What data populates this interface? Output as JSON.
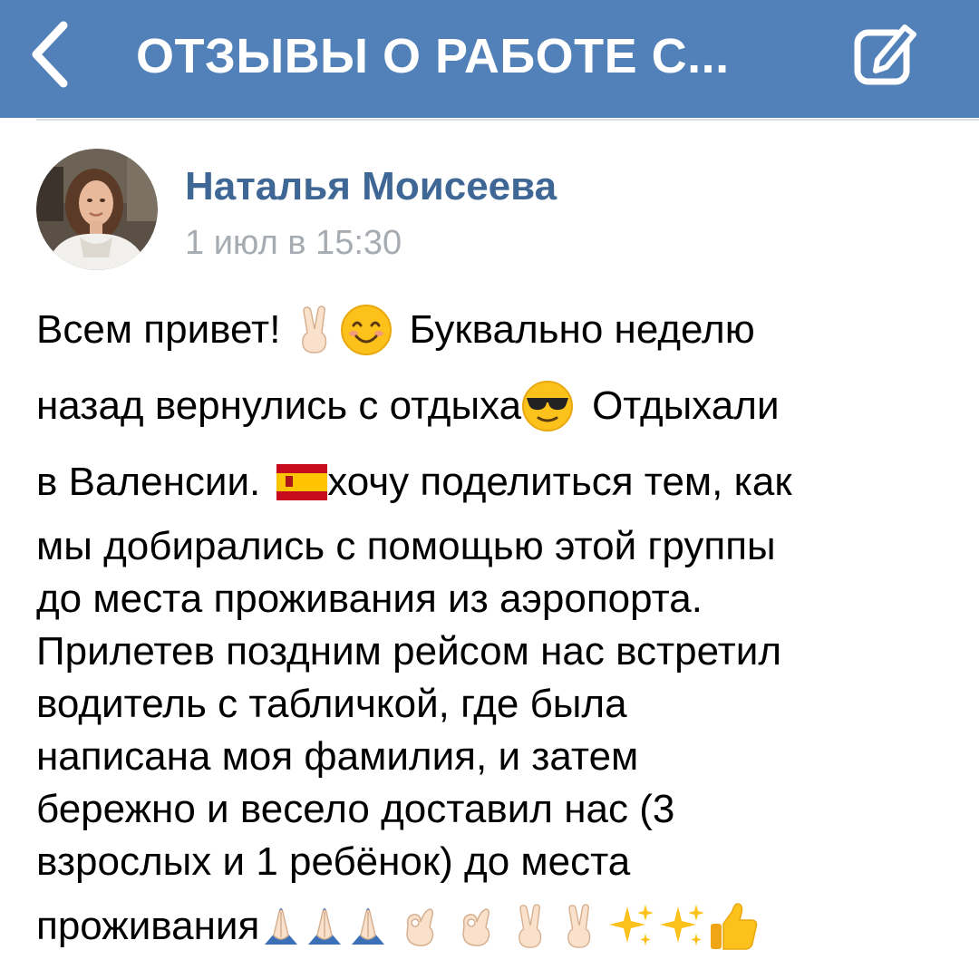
{
  "header": {
    "title": "ОТЗЫВЫ О РАБОТЕ С...",
    "back_icon": "chevron-left-icon",
    "edit_icon": "compose-icon",
    "background_color": "#5181b8"
  },
  "post": {
    "author": "Наталья Моисеева",
    "date": "1 июл в 15:30",
    "lines": {
      "l1_a": "Всем привет!",
      "l1_b": "Буквально неделю",
      "l2_a": "назад вернулись с отдыха",
      "l2_b": "Отдыхали",
      "l3_a": "в Валенсии.",
      "l3_b": "хочу поделиться тем, как",
      "l4": "мы добирались с помощью этой группы",
      "l5": "до места проживания из аэропорта.",
      "l6": "Прилетев поздним рейсом нас встретил",
      "l7": "водитель с табличкой, где была",
      "l8": "написана моя фамилия, и затем",
      "l9": "бережно и весело доставил нас (3",
      "l10": "взрослых и 1 ребёнок) до места",
      "l11": "проживания"
    },
    "emojis": [
      "victory-hand-icon",
      "smiling-face-icon",
      "sunglasses-face-icon",
      "spain-flag-icon",
      "folded-hands-icon",
      "ok-hand-icon",
      "sparkles-icon",
      "thumbs-up-icon"
    ],
    "name_color": "#3f6796",
    "date_color": "#a7acb2"
  }
}
